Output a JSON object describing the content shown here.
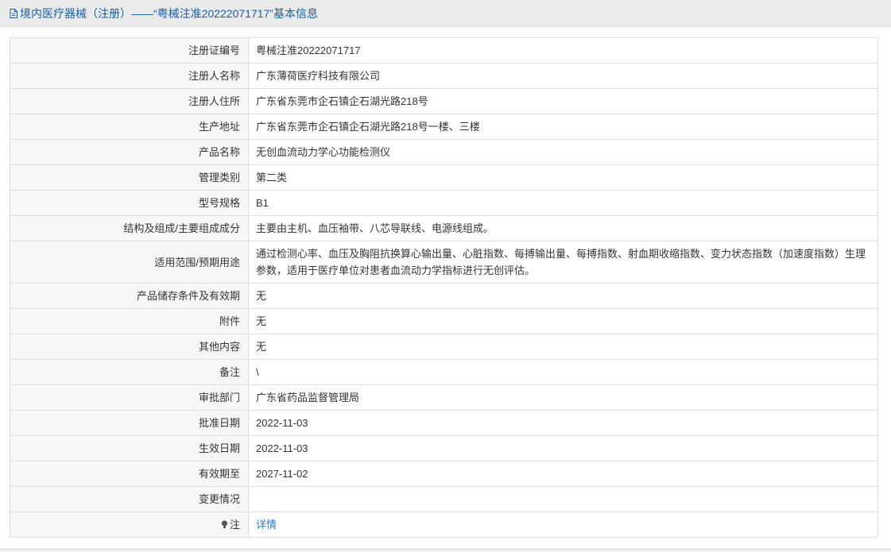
{
  "header": {
    "title": "境内医疗器械（注册）——“粤械注准20222071717”基本信息"
  },
  "rows": [
    {
      "label": "注册证编号",
      "value": "粤械注准20222071717"
    },
    {
      "label": "注册人名称",
      "value": "广东薄荷医疗科技有限公司"
    },
    {
      "label": "注册人住所",
      "value": "广东省东莞市企石镇企石湖光路218号"
    },
    {
      "label": "生产地址",
      "value": "广东省东莞市企石镇企石湖光路218号一楼、三楼"
    },
    {
      "label": "产品名称",
      "value": "无创血流动力学心功能检测仪"
    },
    {
      "label": "管理类别",
      "value": "第二类"
    },
    {
      "label": "型号规格",
      "value": "B1"
    },
    {
      "label": "结构及组成/主要组成成分",
      "value": "主要由主机、血压袖带、八芯导联线、电源线组成。"
    },
    {
      "label": "适用范围/预期用途",
      "value": "通过检测心率、血压及胸阻抗换算心输出量、心脏指数、每搏输出量、每搏指数、射血期收缩指数、变力状态指数（加速度指数）生理参数，适用于医疗单位对患者血流动力学指标进行无创评估。"
    },
    {
      "label": "产品储存条件及有效期",
      "value": "无"
    },
    {
      "label": "附件",
      "value": "无"
    },
    {
      "label": "其他内容",
      "value": "无"
    },
    {
      "label": "备注",
      "value": "\\"
    },
    {
      "label": "审批部门",
      "value": "广东省药品监督管理局"
    },
    {
      "label": "批准日期",
      "value": "2022-11-03"
    },
    {
      "label": "生效日期",
      "value": "2022-11-03"
    },
    {
      "label": "有效期至",
      "value": "2027-11-02"
    },
    {
      "label": "变更情况",
      "value": ""
    }
  ],
  "note": {
    "label": "注",
    "link_text": "详情"
  },
  "icons": {
    "header": "document-icon",
    "note": "lightbulb-icon"
  },
  "colors": {
    "title": "#1a5fa8",
    "link": "#2b7bc9"
  }
}
